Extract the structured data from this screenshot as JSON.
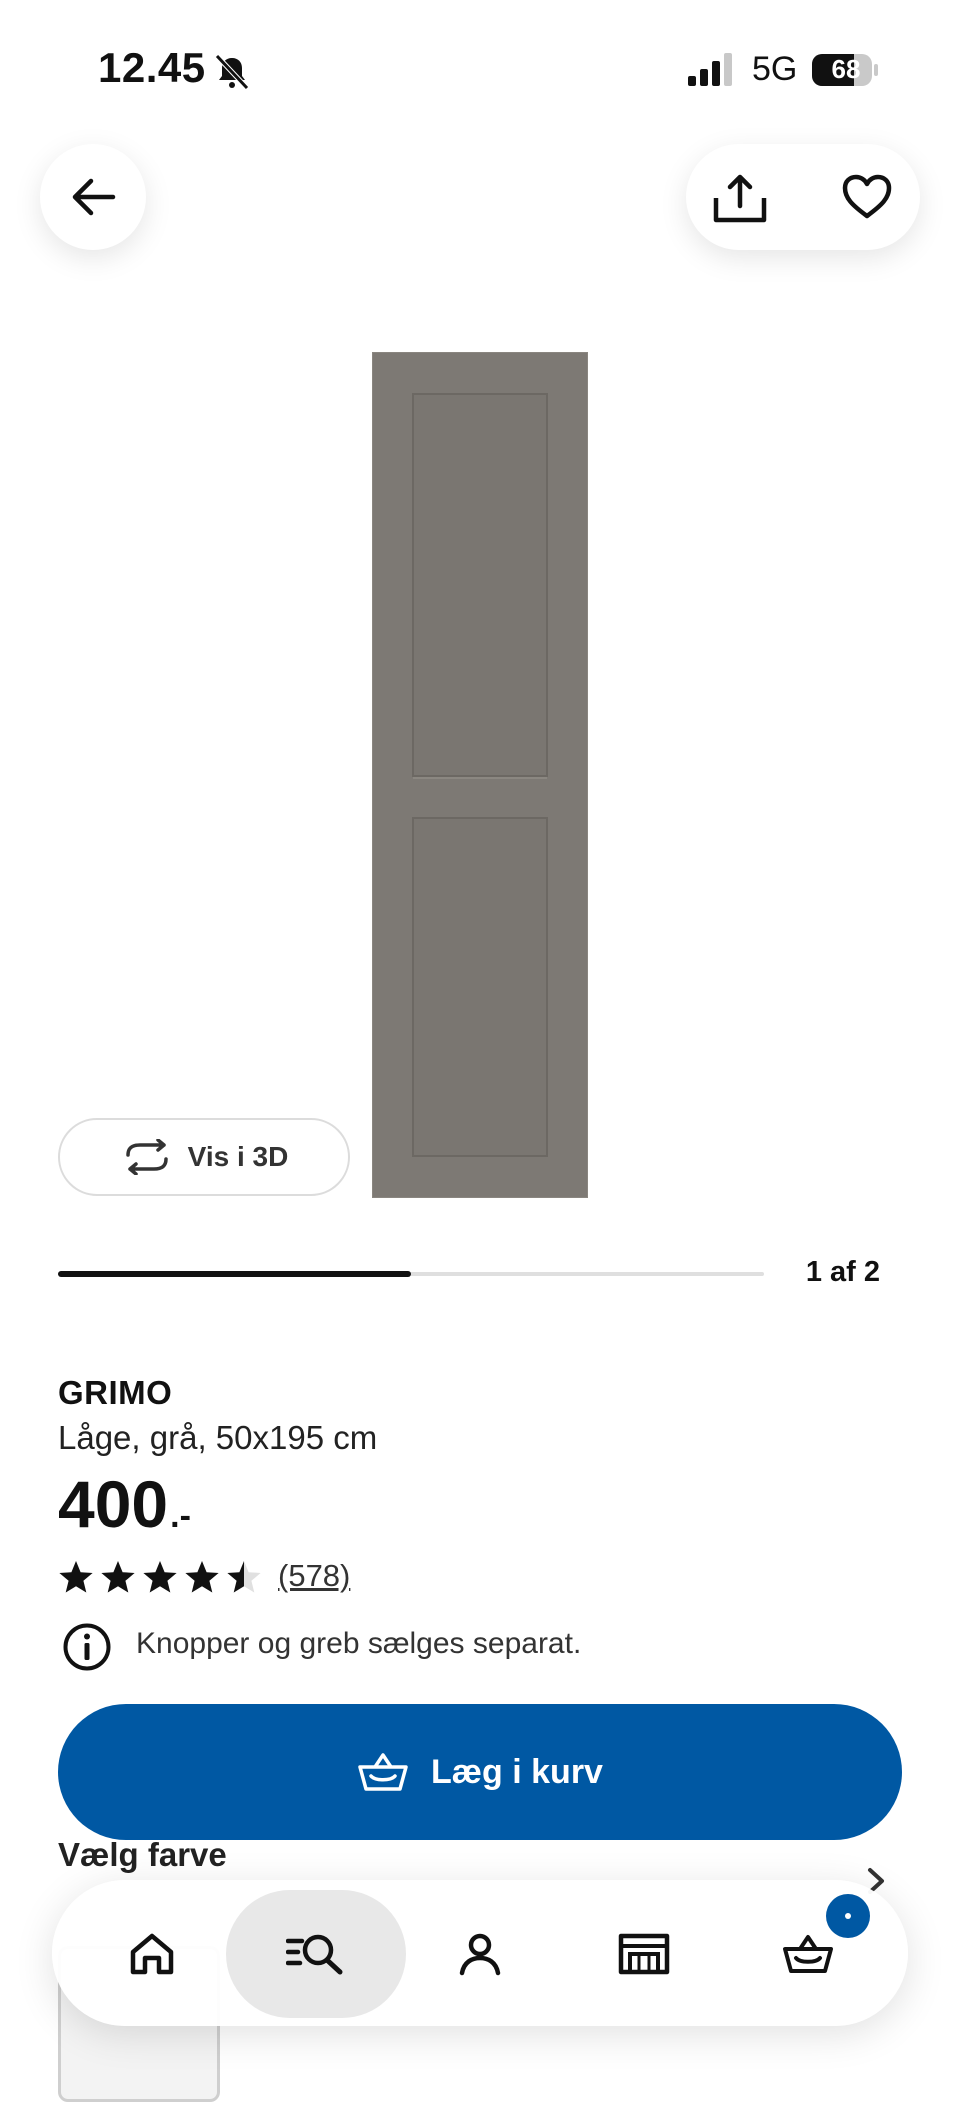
{
  "status_bar": {
    "time": "12.45",
    "network": "5G",
    "battery": "68",
    "icons": [
      "bell-slash-icon",
      "signal-icon",
      "battery-icon"
    ]
  },
  "top_nav": {
    "icons": [
      "back-arrow-icon",
      "share-icon",
      "heart-icon"
    ]
  },
  "gallery": {
    "vis3d_label": "Vis i 3D",
    "page_counter": "1 af 2",
    "progress": 0.5
  },
  "product": {
    "brand": "GRIMO",
    "description": "Låge, grå, 50x195 cm",
    "price": "400",
    "price_suffix": ".-",
    "rating": 4.5,
    "review_count": "(578)",
    "info_text": "Knopper og greb sælges separat."
  },
  "cart_button": {
    "label": "Læg i kurv"
  },
  "color_section": {
    "title": "Vælg farve"
  },
  "bottom_nav": {
    "items": [
      "home-icon",
      "search-icon",
      "profile-icon",
      "store-icon",
      "cart-icon"
    ],
    "active": "search-icon"
  },
  "colors": {
    "primary_blue": "#0058a3",
    "door_gray": "#7d7974",
    "text": "#111111"
  }
}
